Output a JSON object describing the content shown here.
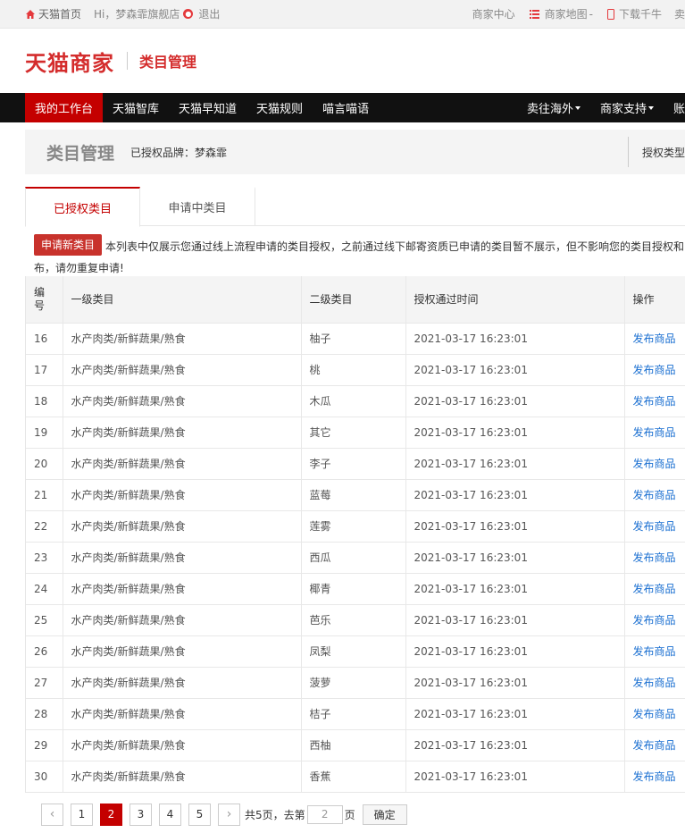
{
  "topbar": {
    "home_label": "天猫首页",
    "greeting": "Hi，梦森霏旗舰店",
    "logout": "退出",
    "merchant_center": "商家中心",
    "merchant_map": "商家地图",
    "download": "下载千牛",
    "trail": "卖"
  },
  "brand": {
    "logo": "天猫商家",
    "section": "类目管理"
  },
  "nav": {
    "tabs": [
      "我的工作台",
      "天猫智库",
      "天猫早知道",
      "天猫规则",
      "喵言喵语"
    ],
    "right": [
      "卖往海外",
      "商家支持",
      "账"
    ]
  },
  "page_head": {
    "title": "类目管理",
    "brand_label": "已授权品牌：梦森霏",
    "auth_type": "授权类型"
  },
  "subtabs": [
    "已授权类目",
    "申请中类目"
  ],
  "notice": {
    "apply_button": "申请新类目",
    "line1": "本列表中仅展示您通过线上流程申请的类目授权，之前通过线下邮寄资质已申请的类目暂不展示，但不影响您的类目授权和",
    "line2": "布，请勿重复申请!"
  },
  "table": {
    "headers": [
      "编号",
      "一级类目",
      "二级类目",
      "授权通过时间",
      "操作"
    ],
    "rows": [
      {
        "no": "16",
        "cat1": "水产肉类/新鲜蔬果/熟食",
        "cat2": "柚子",
        "time": "2021-03-17 16:23:01",
        "action": "发布商品"
      },
      {
        "no": "17",
        "cat1": "水产肉类/新鲜蔬果/熟食",
        "cat2": "桃",
        "time": "2021-03-17 16:23:01",
        "action": "发布商品"
      },
      {
        "no": "18",
        "cat1": "水产肉类/新鲜蔬果/熟食",
        "cat2": "木瓜",
        "time": "2021-03-17 16:23:01",
        "action": "发布商品"
      },
      {
        "no": "19",
        "cat1": "水产肉类/新鲜蔬果/熟食",
        "cat2": "其它",
        "time": "2021-03-17 16:23:01",
        "action": "发布商品"
      },
      {
        "no": "20",
        "cat1": "水产肉类/新鲜蔬果/熟食",
        "cat2": "李子",
        "time": "2021-03-17 16:23:01",
        "action": "发布商品"
      },
      {
        "no": "21",
        "cat1": "水产肉类/新鲜蔬果/熟食",
        "cat2": "蓝莓",
        "time": "2021-03-17 16:23:01",
        "action": "发布商品"
      },
      {
        "no": "22",
        "cat1": "水产肉类/新鲜蔬果/熟食",
        "cat2": "莲雾",
        "time": "2021-03-17 16:23:01",
        "action": "发布商品"
      },
      {
        "no": "23",
        "cat1": "水产肉类/新鲜蔬果/熟食",
        "cat2": "西瓜",
        "time": "2021-03-17 16:23:01",
        "action": "发布商品"
      },
      {
        "no": "24",
        "cat1": "水产肉类/新鲜蔬果/熟食",
        "cat2": "椰青",
        "time": "2021-03-17 16:23:01",
        "action": "发布商品"
      },
      {
        "no": "25",
        "cat1": "水产肉类/新鲜蔬果/熟食",
        "cat2": "芭乐",
        "time": "2021-03-17 16:23:01",
        "action": "发布商品"
      },
      {
        "no": "26",
        "cat1": "水产肉类/新鲜蔬果/熟食",
        "cat2": "凤梨",
        "time": "2021-03-17 16:23:01",
        "action": "发布商品"
      },
      {
        "no": "27",
        "cat1": "水产肉类/新鲜蔬果/熟食",
        "cat2": "菠萝",
        "time": "2021-03-17 16:23:01",
        "action": "发布商品"
      },
      {
        "no": "28",
        "cat1": "水产肉类/新鲜蔬果/熟食",
        "cat2": "桔子",
        "time": "2021-03-17 16:23:01",
        "action": "发布商品"
      },
      {
        "no": "29",
        "cat1": "水产肉类/新鲜蔬果/熟食",
        "cat2": "西柚",
        "time": "2021-03-17 16:23:01",
        "action": "发布商品"
      },
      {
        "no": "30",
        "cat1": "水产肉类/新鲜蔬果/熟食",
        "cat2": "香蕉",
        "time": "2021-03-17 16:23:01",
        "action": "发布商品"
      }
    ]
  },
  "pager": {
    "prev": "‹",
    "pages": [
      "1",
      "2",
      "3",
      "4",
      "5"
    ],
    "current": "2",
    "next": "›",
    "total": "共5页，去第",
    "goto_value": "2",
    "page_suffix": "页",
    "confirm": "确定"
  },
  "colors": {
    "accent": "#c40000",
    "link": "#1a6fd1",
    "nav_bg": "#111111"
  }
}
